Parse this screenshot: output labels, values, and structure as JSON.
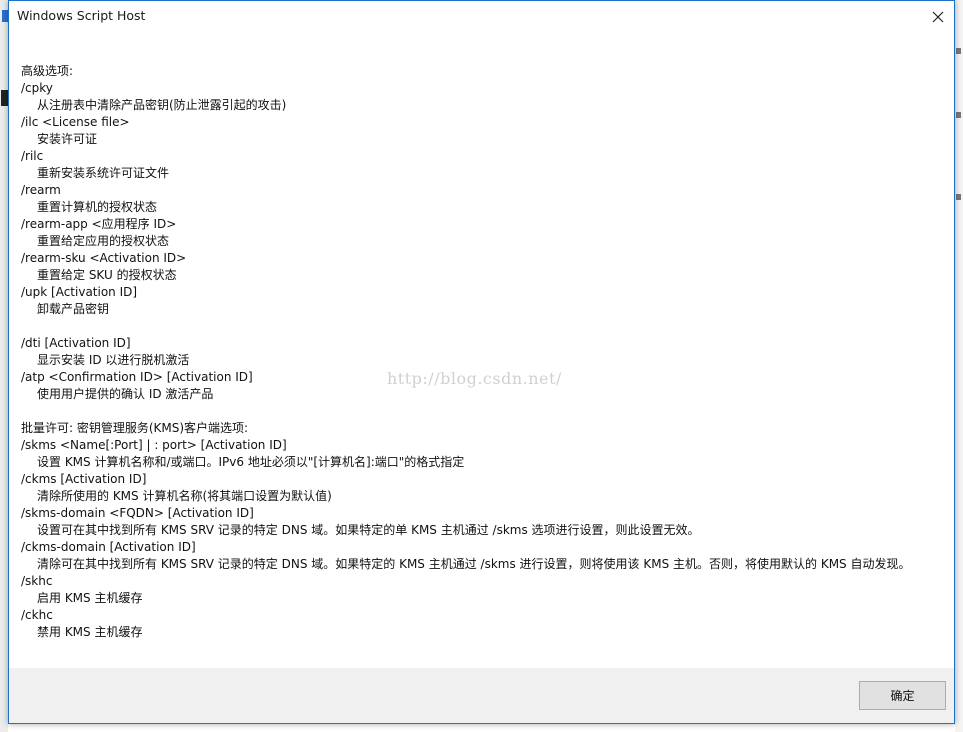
{
  "dialog": {
    "title": "Windows Script Host",
    "ok_label": "确定"
  },
  "watermark": "http://blog.csdn.net/",
  "lines": [
    {
      "text": "高级选项:",
      "indent": false
    },
    {
      "text": "/cpky",
      "indent": false
    },
    {
      "text": "从注册表中清除产品密钥(防止泄露引起的攻击)",
      "indent": true
    },
    {
      "text": "/ilc <License file>",
      "indent": false
    },
    {
      "text": "安装许可证",
      "indent": true
    },
    {
      "text": "/rilc",
      "indent": false
    },
    {
      "text": "重新安装系统许可证文件",
      "indent": true
    },
    {
      "text": "/rearm",
      "indent": false
    },
    {
      "text": "重置计算机的授权状态",
      "indent": true
    },
    {
      "text": "/rearm-app <应用程序 ID>",
      "indent": false
    },
    {
      "text": "重置给定应用的授权状态",
      "indent": true
    },
    {
      "text": "/rearm-sku <Activation ID>",
      "indent": false
    },
    {
      "text": "重置给定 SKU 的授权状态",
      "indent": true
    },
    {
      "text": "/upk [Activation ID]",
      "indent": false
    },
    {
      "text": "卸载产品密钥",
      "indent": true
    },
    {
      "text": "",
      "indent": false
    },
    {
      "text": "/dti [Activation ID]",
      "indent": false
    },
    {
      "text": "显示安装 ID 以进行脱机激活",
      "indent": true
    },
    {
      "text": "/atp <Confirmation ID> [Activation ID]",
      "indent": false
    },
    {
      "text": "使用用户提供的确认 ID 激活产品",
      "indent": true
    },
    {
      "text": "",
      "indent": false
    },
    {
      "text": "批量许可: 密钥管理服务(KMS)客户端选项:",
      "indent": false
    },
    {
      "text": "/skms <Name[:Port] | : port> [Activation ID]",
      "indent": false
    },
    {
      "text": "设置 KMS 计算机名称和/或端口。IPv6 地址必须以\"[计算机名]:端口\"的格式指定",
      "indent": true
    },
    {
      "text": "/ckms [Activation ID]",
      "indent": false
    },
    {
      "text": "清除所使用的 KMS 计算机名称(将其端口设置为默认值)",
      "indent": true
    },
    {
      "text": "/skms-domain <FQDN> [Activation ID]",
      "indent": false
    },
    {
      "text": "设置可在其中找到所有 KMS SRV 记录的特定 DNS 域。如果特定的单 KMS 主机通过 /skms 选项进行设置，则此设置无效。",
      "indent": true
    },
    {
      "text": "/ckms-domain [Activation ID]",
      "indent": false
    },
    {
      "text": "清除可在其中找到所有 KMS SRV 记录的特定 DNS 域。如果特定的 KMS 主机通过 /skms 进行设置，则将使用该 KMS 主机。否则，将使用默认的 KMS 自动发现。",
      "indent": true
    },
    {
      "text": "/skhc",
      "indent": false
    },
    {
      "text": "启用 KMS 主机缓存",
      "indent": true
    },
    {
      "text": "/ckhc",
      "indent": false
    },
    {
      "text": "禁用 KMS 主机缓存",
      "indent": true
    }
  ]
}
